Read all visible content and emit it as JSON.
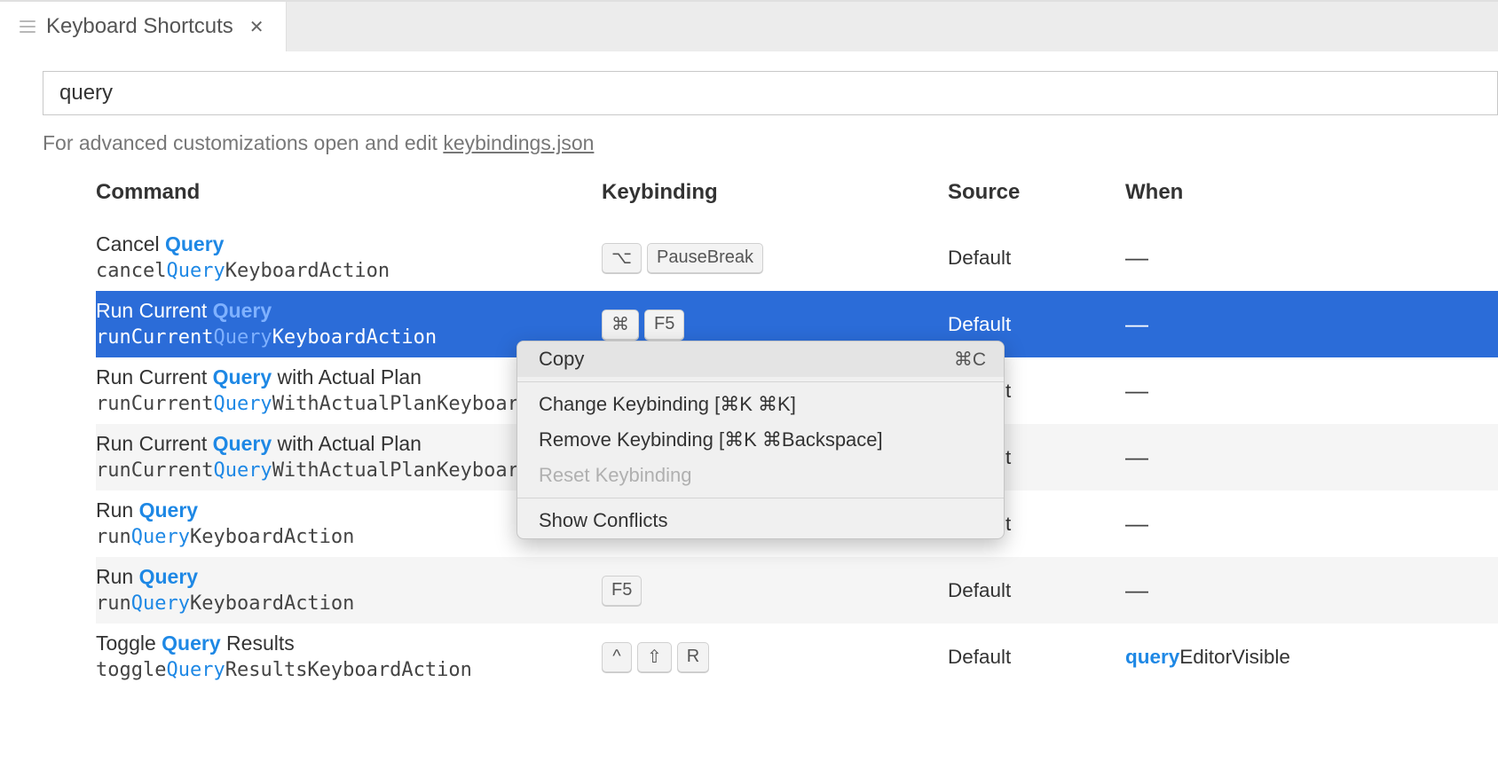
{
  "tab": {
    "title": "Keyboard Shortcuts"
  },
  "search": {
    "value": "query"
  },
  "hint": {
    "prefix": "For advanced customizations open and edit ",
    "link": "keybindings.json"
  },
  "headers": {
    "command": "Command",
    "keybinding": "Keybinding",
    "source": "Source",
    "when": "When"
  },
  "rows": [
    {
      "title_pre": "Cancel ",
      "title_hl": "Query",
      "title_post": "",
      "id_pre": "cancel",
      "id_hl": "Query",
      "id_post": "KeyboardAction",
      "keys": [
        "⌥",
        "PauseBreak"
      ],
      "source": "Default",
      "when": "—",
      "alt": false,
      "selected": false
    },
    {
      "title_pre": "Run Current ",
      "title_hl": "Query",
      "title_post": "",
      "id_pre": "runCurrent",
      "id_hl": "Query",
      "id_post": "KeyboardAction",
      "keys": [
        "⌘",
        "F5"
      ],
      "source": "Default",
      "when": "—",
      "alt": false,
      "selected": true
    },
    {
      "title_pre": "Run Current ",
      "title_hl": "Query",
      "title_post": " with Actual Plan",
      "id_pre": "runCurrent",
      "id_hl": "Query",
      "id_post": "WithActualPlanKeyboardAction",
      "keys": [],
      "source": "Default",
      "when": "—",
      "alt": false,
      "selected": false
    },
    {
      "title_pre": "Run Current ",
      "title_hl": "Query",
      "title_post": " with Actual Plan",
      "id_pre": "runCurrent",
      "id_hl": "Query",
      "id_post": "WithActualPlanKeyboardAction",
      "keys": [],
      "source": "Default",
      "when": "—",
      "alt": true,
      "selected": false
    },
    {
      "title_pre": "Run ",
      "title_hl": "Query",
      "title_post": "",
      "id_pre": "run",
      "id_hl": "Query",
      "id_post": "KeyboardAction",
      "keys": [],
      "source": "Default",
      "when": "—",
      "alt": false,
      "selected": false
    },
    {
      "title_pre": "Run ",
      "title_hl": "Query",
      "title_post": "",
      "id_pre": "run",
      "id_hl": "Query",
      "id_post": "KeyboardAction",
      "keys": [
        "F5"
      ],
      "source": "Default",
      "when": "—",
      "alt": true,
      "selected": false
    },
    {
      "title_pre": "Toggle ",
      "title_hl": "Query",
      "title_post": " Results",
      "id_pre": "toggle",
      "id_hl": "Query",
      "id_post": "ResultsKeyboardAction",
      "keys": [
        "^",
        "⇧",
        "R"
      ],
      "source": "Default",
      "when_hl": "query",
      "when_post": "EditorVisible",
      "alt": false,
      "selected": false
    }
  ],
  "context_menu": {
    "items": [
      {
        "label": "Copy",
        "shortcut": "⌘C",
        "disabled": false,
        "hover": true
      },
      {
        "sep": true
      },
      {
        "label": "Change Keybinding [⌘K ⌘K]",
        "shortcut": "",
        "disabled": false
      },
      {
        "label": "Remove Keybinding [⌘K ⌘Backspace]",
        "shortcut": "",
        "disabled": false
      },
      {
        "label": "Reset Keybinding",
        "shortcut": "",
        "disabled": true
      },
      {
        "sep": true
      },
      {
        "label": "Show Conflicts",
        "shortcut": "",
        "disabled": false
      }
    ]
  }
}
